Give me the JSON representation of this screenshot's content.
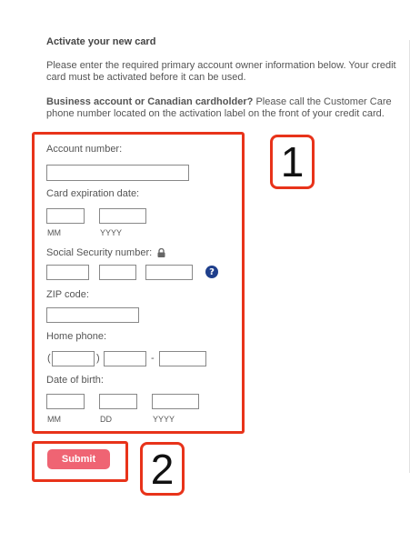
{
  "header": {
    "title": "Activate your new card",
    "intro": "Please enter the required primary account owner information below. Your credit card must be activated before it can be used.",
    "note_bold": "Business account or Canadian cardholder?",
    "note_rest": " Please call the Customer Care phone number located on the activation label on the front of your credit card."
  },
  "form": {
    "account_number_label": "Account number:",
    "expiration_label": "Card expiration date:",
    "exp_mm": "MM",
    "exp_yyyy": "YYYY",
    "ssn_label": "Social Security number:",
    "zip_label": "ZIP code:",
    "home_phone_label": "Home phone:",
    "phone_open": "(",
    "phone_close": ")",
    "phone_dash": "-",
    "dob_label": "Date of birth:",
    "dob_mm": "MM",
    "dob_dd": "DD",
    "dob_yyyy": "YYYY",
    "help_glyph": "?"
  },
  "submit_label": "Submit",
  "annotations": {
    "callout_1": "1",
    "callout_2": "2",
    "color": "#e8331a"
  },
  "icons": {
    "lock": "lock-icon",
    "help": "help-icon"
  }
}
